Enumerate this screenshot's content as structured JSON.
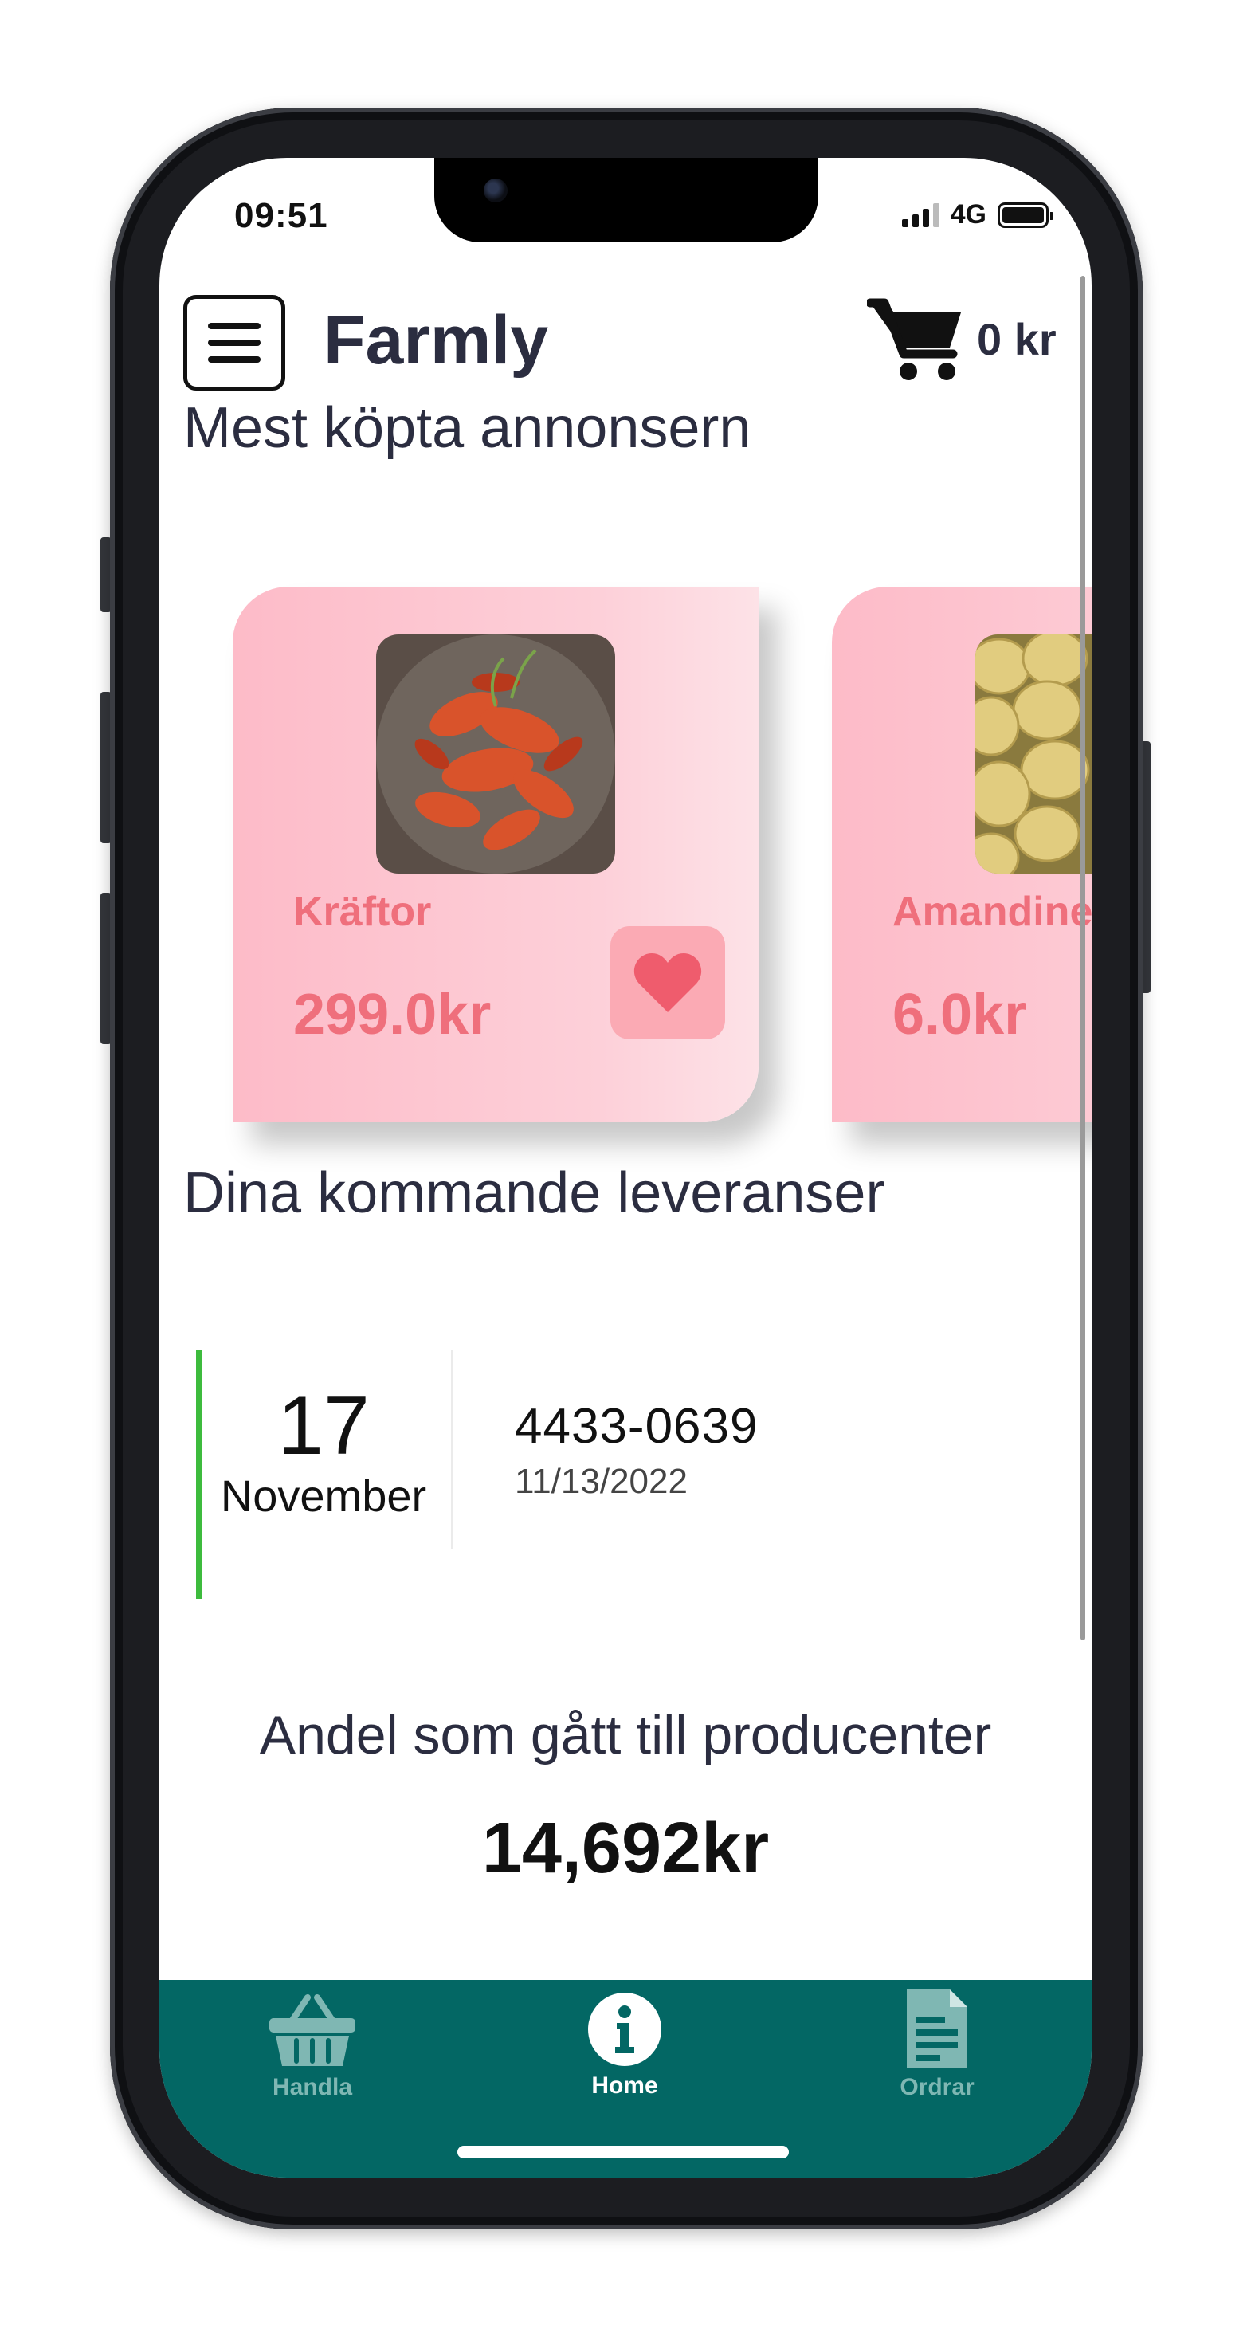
{
  "status_bar": {
    "time": "09:51",
    "network": "4G"
  },
  "header": {
    "app_title": "Farmly",
    "cart_total": "0 kr"
  },
  "popular_section": {
    "title": "Mest köpta annonsern",
    "products": [
      {
        "name": "Kräftor",
        "price": "299.0kr",
        "image": "crayfish-photo"
      },
      {
        "name": "Amandine",
        "price": "6.0kr",
        "image": "potatoes-photo"
      }
    ]
  },
  "deliveries_section": {
    "title": "Dina kommande leveranser",
    "items": [
      {
        "day": "17",
        "month": "November",
        "order_number": "4433-0639",
        "date": "11/13/2022"
      }
    ]
  },
  "producer_share": {
    "label": "Andel som gått till producenter",
    "value": "14,692kr"
  },
  "bottom_nav": {
    "items": [
      {
        "label": "Handla",
        "icon": "basket-icon",
        "active": false
      },
      {
        "label": "Home",
        "icon": "info-icon",
        "active": true
      },
      {
        "label": "Ordrar",
        "icon": "document-icon",
        "active": false
      }
    ]
  },
  "colors": {
    "nav_background": "#036764",
    "card_pink": "#fdbbc8",
    "price_red": "#ef6f7c",
    "delivery_accent": "#3dbb3d",
    "title_text": "#2b2d40"
  }
}
